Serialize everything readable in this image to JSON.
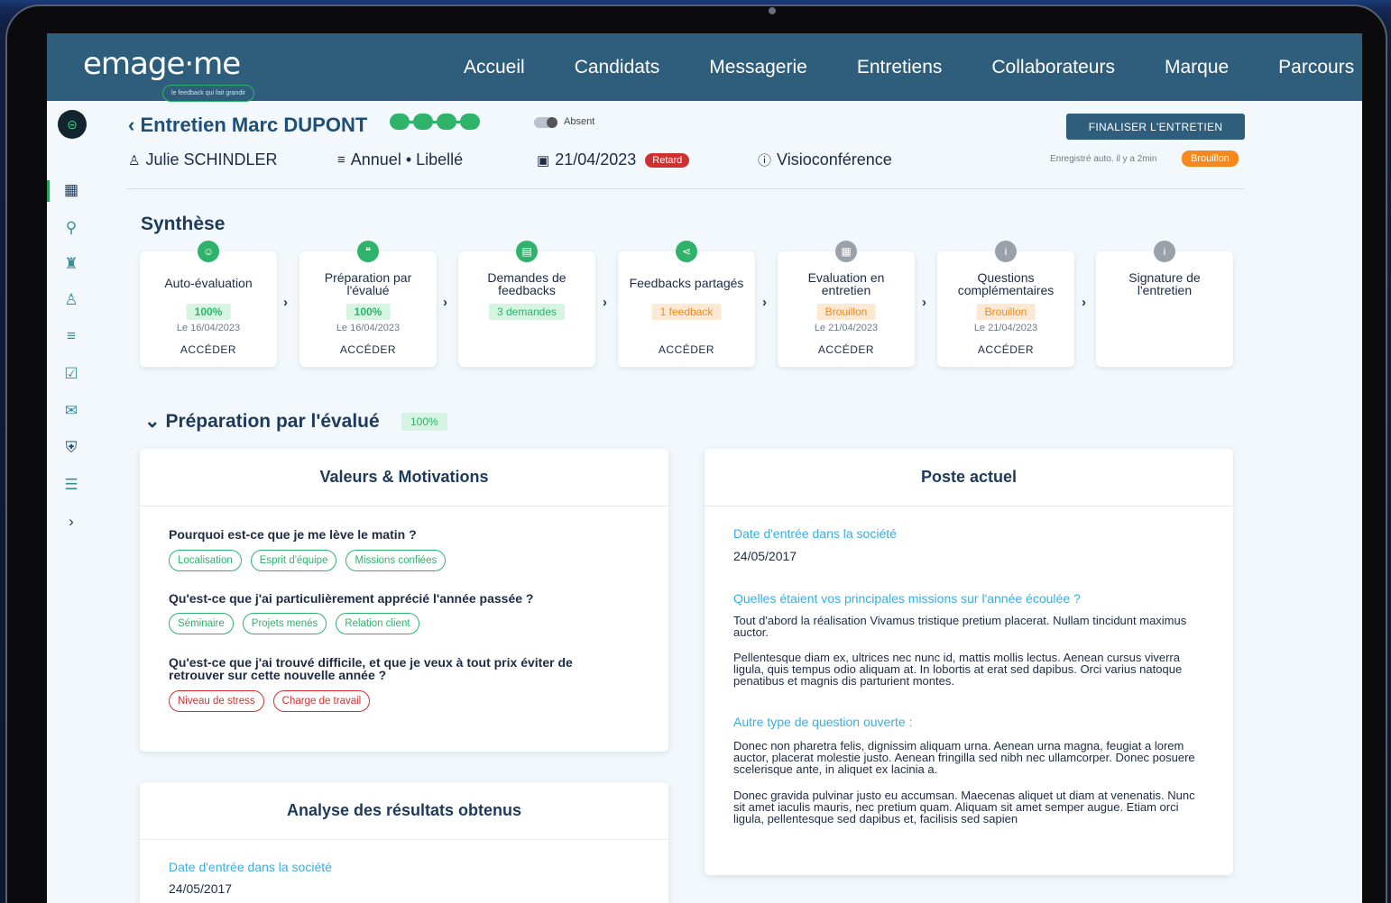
{
  "app": {
    "logo_text": "emage·me",
    "logo_tagline": "le feedback qui fait grandir"
  },
  "nav": {
    "items": [
      "Accueil",
      "Candidats",
      "Messagerie",
      "Entretiens",
      "Collaborateurs",
      "Marque",
      "Parcours"
    ]
  },
  "sidebar": {
    "icons": [
      "dashboard-icon",
      "candidate-search-icon",
      "graduate-icon",
      "team-icon",
      "list-check-icon",
      "checklist-icon",
      "mail-icon",
      "shield-icon",
      "list-icon",
      "chevron-right-icon"
    ]
  },
  "header": {
    "title": "Entretien Marc DUPONT",
    "back_glyph": "‹",
    "absent_label": "Absent",
    "finalize_label": "FINALISER L'ENTRETIEN",
    "manager": "Julie SCHINDLER",
    "type": "Annuel • Libellé",
    "date": "21/04/2023",
    "late_badge": "Retard",
    "mode": "Visioconférence",
    "saved_text": "Enregistré auto. il y a 2min",
    "status_badge": "Brouillon"
  },
  "synthese": {
    "title": "Synthèse",
    "cards": [
      {
        "title": "Auto-évaluation",
        "pill": "100%",
        "pill_style": "green",
        "date": "Le 16/04/2023",
        "access": "ACCÉDER",
        "icon_style": "green",
        "icon": "user-icon"
      },
      {
        "title": "Préparation par l'évalué",
        "pill": "100%",
        "pill_style": "green",
        "date": "Le 16/04/2023",
        "access": "ACCÉDER",
        "icon_style": "green",
        "icon": "chat-icon"
      },
      {
        "title": "Demandes de feedbacks",
        "pill": "3 demandes",
        "pill_style": "green",
        "date": "",
        "access": "",
        "icon_style": "green",
        "icon": "message-icon"
      },
      {
        "title": "Feedbacks partagés",
        "pill": "1 feedback",
        "pill_style": "orange",
        "date": "",
        "access": "ACCÉDER",
        "icon_style": "green",
        "icon": "share-icon"
      },
      {
        "title": "Evaluation en entretien",
        "pill": "Brouillon",
        "pill_style": "orange",
        "date": "Le 21/04/2023",
        "access": "ACCÉDER",
        "icon_style": "grey",
        "icon": "grid-icon"
      },
      {
        "title": "Questions complémentaires",
        "pill": "Brouillon",
        "pill_style": "orange",
        "date": "Le 21/04/2023",
        "access": "ACCÉDER",
        "icon_style": "grey",
        "icon": "info-icon"
      },
      {
        "title": "Signature de l'entretien",
        "pill": "",
        "pill_style": "",
        "date": "",
        "access": "",
        "icon_style": "grey",
        "icon": "info-icon"
      }
    ]
  },
  "preparation": {
    "title": "Préparation par l'évalué",
    "badge": "100%",
    "values_panel": {
      "title": "Valeurs & Motivations",
      "q1": "Pourquoi est-ce que je me lève le matin ?",
      "q1_tags": [
        "Localisation",
        "Esprit d'équipe",
        "Missions confiées"
      ],
      "q2": "Qu'est-ce que j'ai particulièrement apprécié l'année passée ?",
      "q2_tags": [
        "Séminaire",
        "Projets menés",
        "Relation client"
      ],
      "q3_line1": "Qu'est-ce que j'ai trouvé difficile, et que je veux à tout prix éviter de",
      "q3_line2": "retrouver sur cette nouvelle année ?",
      "q3_tags": [
        "Niveau de stress",
        "Charge de travail"
      ]
    },
    "analysis_panel": {
      "title": "Analyse des résultats obtenus",
      "label": "Date d'entrée dans la société",
      "value": "24/05/2017"
    },
    "poste_panel": {
      "title": "Poste actuel",
      "label1": "Date d'entrée dans la société",
      "value1": "24/05/2017",
      "label2": "Quelles étaient vos principales missions sur l'année écoulée ?",
      "p1": "Tout d'abord la réalisation Vivamus tristique pretium placerat. Nullam tincidunt maximus auctor.",
      "p2": "Pellentesque diam ex, ultrices nec nunc id, mattis mollis lectus. Aenean cursus viverra ligula, quis tempus odio aliquam at. In lobortis at erat sed dapibus. Orci varius natoque penatibus et magnis dis parturient montes.",
      "label3": "Autre type de question ouverte :",
      "p3": "Donec non pharetra felis, dignissim aliquam urna. Aenean urna magna, feugiat a lorem auctor, placerat molestie justo. Aenean fringilla sed nibh nec ullamcorper. Donec posuere scelerisque ante, in aliquet ex lacinia a.",
      "p4": "Donec gravida pulvinar justo eu accumsan. Maecenas aliquet ut diam at venenatis. Nunc sit amet iaculis mauris, nec pretium quam. Aliquam sit amet semper augue. Etiam orci ligula, pellentesque sed dapibus et, facilisis sed sapien"
    }
  },
  "colors": {
    "nav_bg": "#2e5e7c",
    "accent_green": "#2fb36a",
    "accent_orange": "#f5891f",
    "accent_red": "#d0302f",
    "link_blue": "#39aee0"
  }
}
